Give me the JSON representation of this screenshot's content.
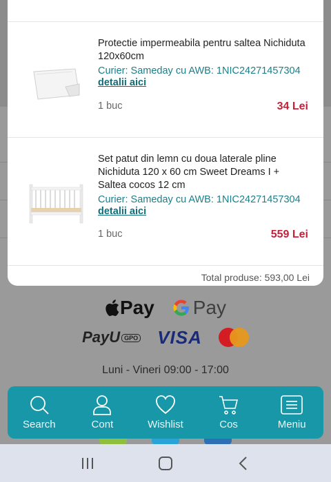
{
  "items": [
    {
      "title": "Protectie impermeabila pentru saltea Nichiduta 120x60cm",
      "courier": "Curier: Sameday cu AWB: 1NIC24271457304",
      "details_label": "detalii aici",
      "qty": "1 buc",
      "price": "34 Lei"
    },
    {
      "title": "Set patut din lemn cu doua laterale pline Nichiduta 120 x 60 cm Sweet Dreams I + Saltea cocos 12 cm",
      "courier": "Curier: Sameday cu AWB: 1NIC24271457304",
      "details_label": "detalii aici",
      "qty": "1 buc",
      "price": "559 Lei"
    }
  ],
  "total_peek": "Total produse: 593,00 Lei",
  "payments": {
    "apple_pay": "Pay",
    "google_pay": "Pay",
    "payu": "PayU",
    "payu_badge": "GPO",
    "visa": "VISA"
  },
  "hours": "Luni - Vineri 09:00 - 17:00",
  "nav": {
    "search": "Search",
    "account": "Cont",
    "wishlist": "Wishlist",
    "cart": "Cos",
    "menu": "Meniu"
  },
  "colors": {
    "accent": "#1797a7",
    "price": "#c3203a",
    "courier": "#1a7f8a"
  }
}
